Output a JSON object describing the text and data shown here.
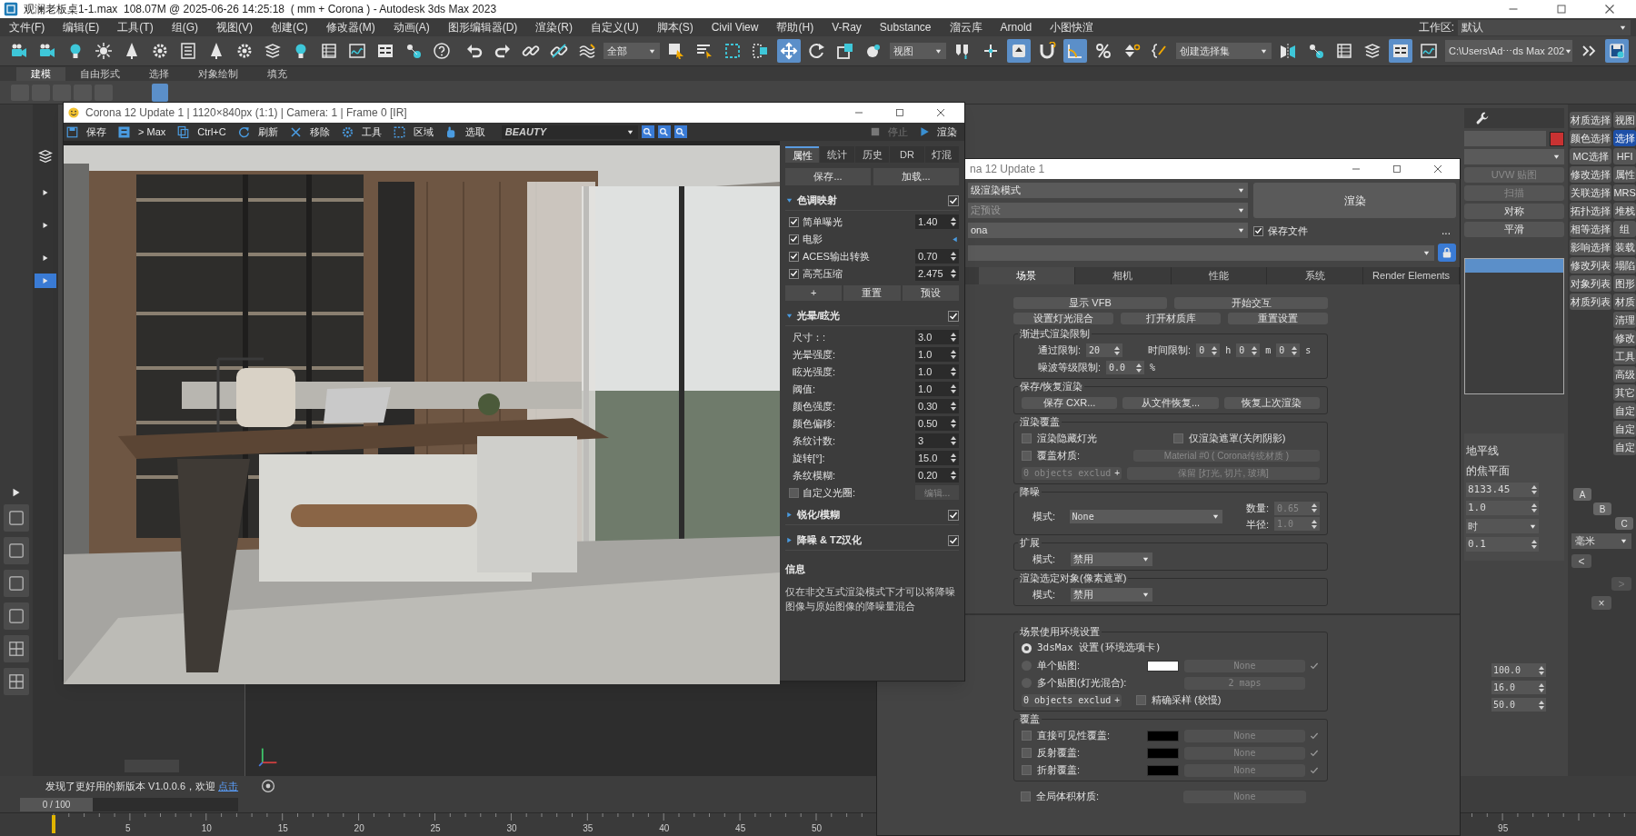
{
  "title_bar": {
    "title": "观澜老板桌1-1.max  108.07M @ 2025-06-26 14:25:18  ( mm + Corona ) - Autodesk 3ds Max 2023"
  },
  "menu_bar": {
    "items": [
      "文件(F)",
      "编辑(E)",
      "工具(T)",
      "组(G)",
      "视图(V)",
      "创建(C)",
      "修改器(M)",
      "动画(A)",
      "图形编辑器(D)",
      "渲染(R)",
      "自定义(U)",
      "脚本(S)",
      "Civil View",
      "帮助(H)",
      "V-Ray",
      "Substance",
      "溜云库",
      "Arnold",
      "小图快渲"
    ],
    "workspace_label": "工作区:",
    "workspace_value": "默认"
  },
  "main_toolbar": {
    "dropdowns": [
      "全部",
      "视图",
      "创建选择集",
      "C:\\Users\\Ad⋯ds Max 202"
    ]
  },
  "ribbon": {
    "tabs": [
      {
        "label": "建模",
        "selected": true
      },
      {
        "label": "自由形式",
        "selected": false
      },
      {
        "label": "选择",
        "selected": false
      },
      {
        "label": "对象绘制",
        "selected": false
      },
      {
        "label": "填充",
        "selected": false
      }
    ]
  },
  "vfb": {
    "title": "Corona 12 Update 1 | 1120×840px (1:1) | Camera: 1 | Frame 0 [IR]",
    "toolbar": [
      "保存",
      "> Max",
      "Ctrl+C",
      "刷新",
      "移除",
      "工具",
      "区域",
      "选取"
    ],
    "channel": "BEAUTY",
    "stop": {
      "label": "停止",
      "disabled": true
    },
    "render": "渲染",
    "tabs": [
      {
        "label": "属性",
        "selected": true
      },
      {
        "label": "统计",
        "selected": false
      },
      {
        "label": "历史",
        "selected": false
      },
      {
        "label": "DR",
        "selected": false
      },
      {
        "label": "灯混",
        "selected": false
      }
    ],
    "file_buttons": [
      "保存...",
      "加载..."
    ],
    "rollouts": [
      {
        "title": "色调映射",
        "expanded": true,
        "enabled": true,
        "rows": [
          {
            "kind": "check-spinner",
            "label": "简单曝光",
            "checked": true,
            "value": "1.40"
          },
          {
            "kind": "check-arrow",
            "label": "电影",
            "checked": true
          },
          {
            "kind": "check-spinner",
            "label": "ACES输出转换",
            "checked": true,
            "value": "0.70"
          },
          {
            "kind": "check-spinner",
            "label": "高亮压缩",
            "checked": true,
            "value": "2.475"
          }
        ],
        "buttons": [
          "+",
          "重置",
          "预设"
        ]
      },
      {
        "title": "光晕/眩光",
        "expanded": true,
        "enabled": true,
        "rows": [
          {
            "kind": "spinner",
            "label": "尺寸：:",
            "value": "3.0"
          },
          {
            "kind": "spinner",
            "label": "光晕强度:",
            "value": "1.0"
          },
          {
            "kind": "spinner",
            "label": "眩光强度:",
            "value": "1.0"
          },
          {
            "kind": "spinner",
            "label": "阈值:",
            "value": "1.0"
          },
          {
            "kind": "spinner",
            "label": "颜色强度:",
            "value": "0.30"
          },
          {
            "kind": "spinner",
            "label": "颜色偏移:",
            "value": "0.50"
          },
          {
            "kind": "spinner",
            "label": "条纹计数:",
            "value": "3"
          },
          {
            "kind": "spinner",
            "label": "旋转[°]:",
            "value": "15.0"
          },
          {
            "kind": "spinner",
            "label": "条纹模糊:",
            "value": "0.20"
          },
          {
            "kind": "check-button",
            "label": "自定义光圈:",
            "checked": false,
            "button": "编辑...",
            "button_disabled": true
          }
        ]
      },
      {
        "title": "锐化/模糊",
        "expanded": false,
        "enabled": true
      },
      {
        "title": "降噪 & TZ汉化",
        "expanded": false,
        "enabled": true
      }
    ],
    "info": {
      "title": "信息",
      "text": "仅在非交互式渲染模式下才可以将降噪图像与原始图像的降噪量混合"
    }
  },
  "render_setup": {
    "title": "na 12 Update 1",
    "dropdowns": [
      {
        "value": "级渲染模式",
        "disabled": false
      },
      {
        "value": "定预设",
        "disabled": true
      },
      {
        "value": "ona",
        "disabled": false
      }
    ],
    "render_button": "渲染",
    "save_file": {
      "label": "保存文件",
      "checked": true
    },
    "more": "...",
    "tabs": [
      {
        "label": "场景",
        "selected": true
      },
      {
        "label": "相机",
        "selected": false
      },
      {
        "label": "性能",
        "selected": false
      },
      {
        "label": "系统",
        "selected": false
      },
      {
        "label": "Render Elements",
        "selected": false
      }
    ],
    "button_rows": [
      [
        "显示 VFB",
        "开始交互"
      ],
      [
        "设置灯光混合",
        "打开材质库",
        "重置设置"
      ]
    ],
    "rollouts": [
      {
        "groups": [
          {
            "title": "渐进式渲染限制",
            "rows": [
              {
                "kind": "fields",
                "items": [
                  {
                    "label": "通过限制:",
                    "value": "20"
                  },
                  {
                    "label": "时间限制:",
                    "value": "0",
                    "unit": "h"
                  },
                  {
                    "value": "0",
                    "unit": "m"
                  },
                  {
                    "value": "0",
                    "unit": "s"
                  }
                ]
              },
              {
                "kind": "fields",
                "items": [
                  {
                    "label": "噪波等级限制:",
                    "value": "0.0",
                    "unit": "%"
                  }
                ]
              }
            ]
          },
          {
            "title": "保存/恢复渲染",
            "rows": [
              {
                "kind": "buttons",
                "items": [
                  "保存 CXR...",
                  "从文件恢复...",
                  "恢复上次渲染"
                ]
              }
            ]
          },
          {
            "title": "渲染覆盖",
            "rows": [
              {
                "kind": "checks",
                "items": [
                  {
                    "label": "渲染隐藏灯光",
                    "checked": false
                  },
                  {
                    "label": "仅渲染遮罩(关闭阴影)",
                    "checked": false
                  }
                ]
              },
              {
                "kind": "check-button",
                "label": "覆盖材质:",
                "checked": false,
                "button": "Material #0 ( Corona传统材质 )",
                "button_disabled": true
              },
              {
                "kind": "exclude",
                "label": "0 objects exclud",
                "plus": "+",
                "button": "保留 [灯光, 切片, 玻璃]",
                "button_disabled": true
              }
            ]
          },
          {
            "title": "降噪",
            "rows": [
              {
                "kind": "dropdown-spinners",
                "label": "模式:",
                "value": "None",
                "disabled": true,
                "items": [
                  {
                    "label": "数量:",
                    "value": "0.65"
                  },
                  {
                    "label": "半径:",
                    "value": "1.0"
                  }
                ]
              }
            ]
          },
          {
            "title": "扩展",
            "rows": [
              {
                "kind": "dropdown",
                "label": "模式:",
                "value": "禁用"
              }
            ]
          },
          {
            "title": "渲染选定对象(像素遮罩)",
            "rows": [
              {
                "kind": "dropdown",
                "label": "模式:",
                "value": "禁用"
              }
            ]
          }
        ]
      },
      {
        "groups": [
          {
            "title": "场景使用环境设置",
            "rows": [
              {
                "kind": "radio",
                "label": "3dsMax 设置(环境选项卡)",
                "selected": true
              },
              {
                "kind": "radio-map",
                "label": "单个贴图:",
                "selected": false,
                "color": "#ffffff",
                "map": "None",
                "map_enabled": true
              },
              {
                "kind": "radio-map",
                "label": "多个贴图(灯光混合):",
                "selected": false,
                "map": "2 maps",
                "map_enabled": false
              },
              {
                "kind": "exclude-check",
                "label": "0 objects exclud",
                "plus": "+",
                "check_label": "精确采样 (较慢)",
                "checked": false
              }
            ]
          },
          {
            "title": "覆盖",
            "rows": [
              {
                "kind": "check-map",
                "label": "直接可见性覆盖:",
                "checked": false,
                "color": "#000000",
                "map": "None",
                "map_enabled": true
              },
              {
                "kind": "check-map",
                "label": "反射覆盖:",
                "checked": false,
                "color": "#000000",
                "map": "None",
                "map_enabled": true
              },
              {
                "kind": "check-map",
                "label": "折射覆盖:",
                "checked": false,
                "color": "#000000",
                "map": "None",
                "map_enabled": true
              }
            ]
          }
        ],
        "rows": [
          {
            "kind": "check-map",
            "label": "全局体积材质:",
            "checked": false,
            "map": "None",
            "map_enabled": false
          }
        ]
      }
    ]
  },
  "command_panel": {
    "buttons": [
      {
        "label": "UVW 贴图",
        "disabled": true
      },
      {
        "label": "扫描",
        "disabled": true
      },
      {
        "label": "对称",
        "disabled": false
      },
      {
        "label": "平滑",
        "disabled": false
      }
    ],
    "params": [
      {
        "kind": "label",
        "text": "地平线"
      },
      {
        "kind": "label",
        "text": "的焦平面"
      },
      {
        "kind": "spinner",
        "text": "8133.45"
      },
      {
        "kind": "spinner",
        "text": "1.0"
      },
      {
        "kind": "dropdown",
        "text": "时"
      },
      {
        "kind": "spinner",
        "text": "0.1"
      }
    ],
    "lower_params": [
      "100.0",
      "16.0",
      "50.0"
    ]
  },
  "tool_column": {
    "left": [
      "材质选择",
      "颜色选择",
      "MC选择",
      "修改选择",
      "关联选择",
      "拓扑选择",
      "相等选择",
      "影响选择",
      "修改列表",
      "对象列表",
      "材质列表"
    ],
    "right": [
      {
        "label": "视图",
        "selected": false
      },
      {
        "label": "选择",
        "selected": true
      },
      {
        "label": "HFI",
        "selected": false
      },
      {
        "label": "属性",
        "selected": false
      },
      {
        "label": "MRS",
        "selected": false
      },
      {
        "label": "堆栈",
        "selected": false
      },
      {
        "label": "组",
        "selected": false
      },
      {
        "label": "装载",
        "selected": false
      },
      {
        "label": "塌陷",
        "selected": false
      },
      {
        "label": "图形",
        "selected": false
      },
      {
        "label": "材质",
        "selected": false
      },
      {
        "label": "清理",
        "selected": false
      },
      {
        "label": "修改",
        "selected": false
      },
      {
        "label": "工具",
        "selected": false
      },
      {
        "label": "高级",
        "selected": false
      },
      {
        "label": "其它",
        "selected": false
      },
      {
        "label": "自定",
        "selected": false
      },
      {
        "label": "自定",
        "selected": false
      },
      {
        "label": "自定",
        "selected": false
      }
    ],
    "views": [
      "A",
      "B",
      "C"
    ],
    "unit": "毫米",
    "prev": "<",
    "next": {
      "label": ">",
      "disabled": true
    },
    "close": "×"
  },
  "status": {
    "message": "发现了更好用的新版本 V1.0.0.6，欢迎",
    "link": "点击"
  },
  "time_slider": {
    "label": "0 / 100",
    "level": 0
  },
  "timeline": {
    "ticks": [
      "5",
      "10",
      "15",
      "20",
      "25",
      "30",
      "35",
      "40",
      "45",
      "50",
      "95"
    ]
  }
}
